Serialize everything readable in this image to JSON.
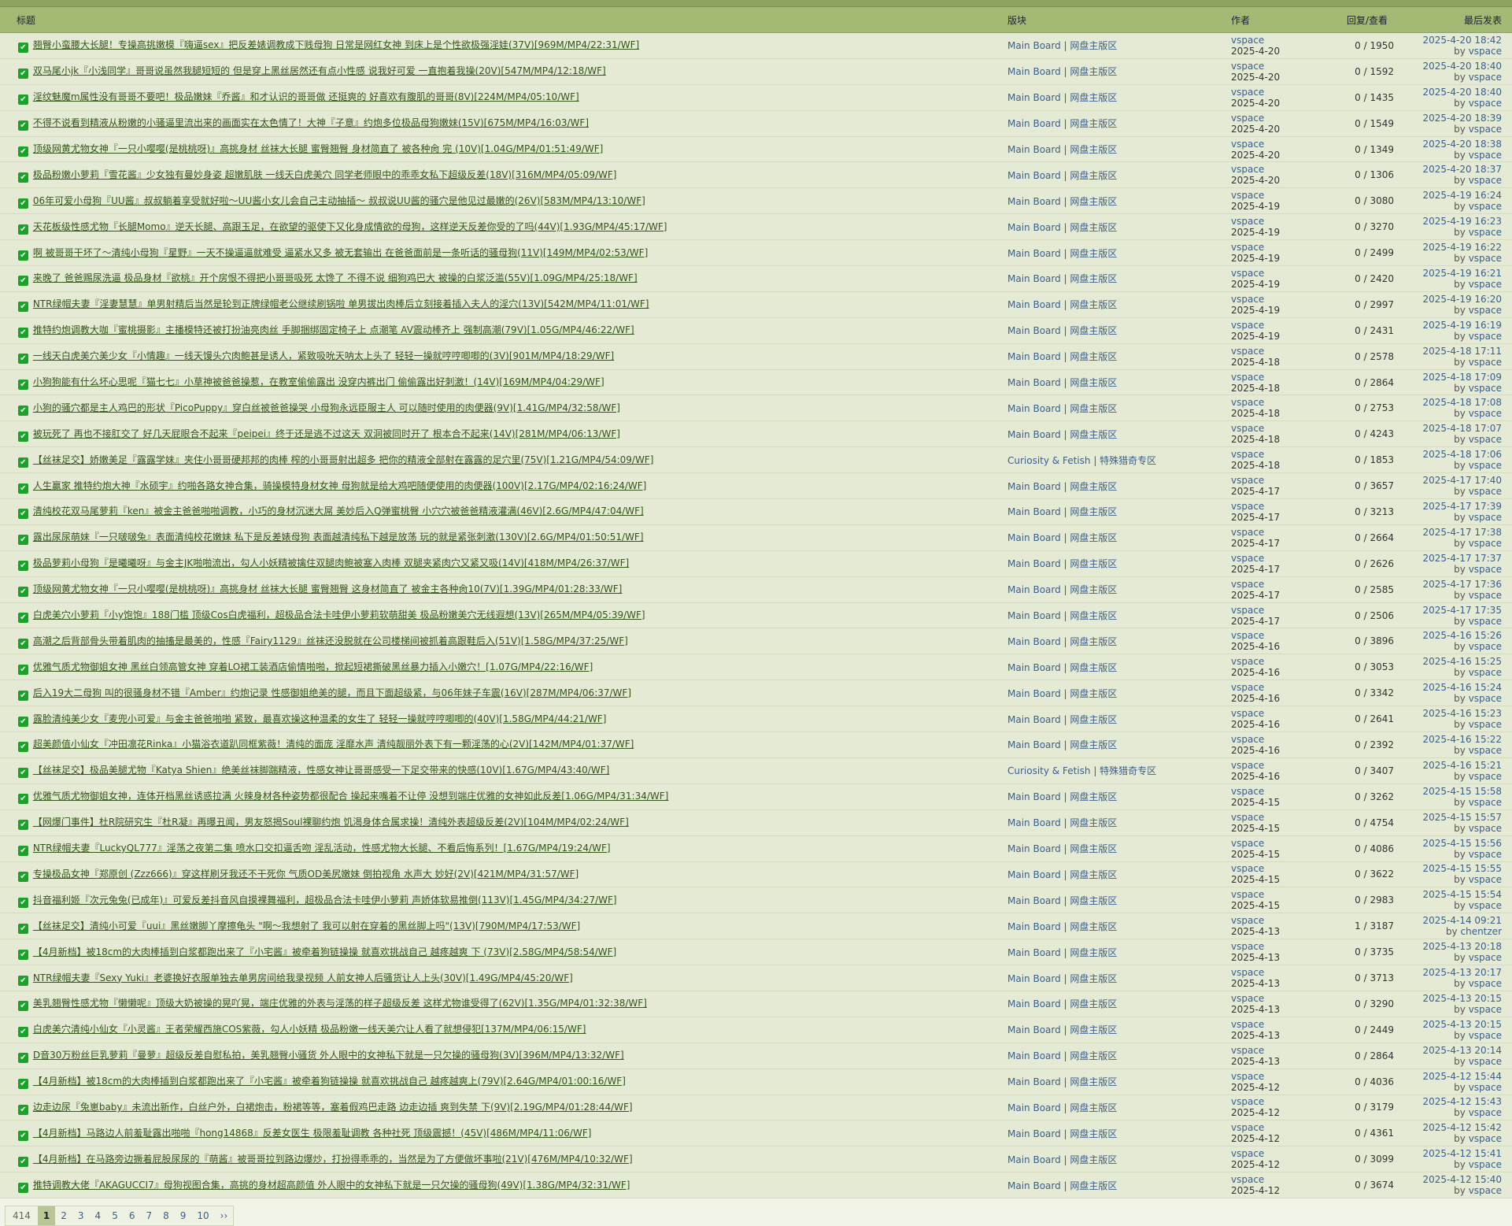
{
  "headers": {
    "title": "标题",
    "forum": "版块",
    "author": "作者",
    "count": "回复/查看",
    "last": "最后发表"
  },
  "threads": [
    {
      "title": "翘臀小蛮腰大长腿！专操高挑嫩模『嗨逼sex』把反差婊调教成下贱母狗 日常是网红女神 到床上是个性欲极强淫娃(37V)[969M/MP4/22:31/WF]",
      "forum": "Main Board | 网盘主版区",
      "author": "vspace",
      "date": "2025-4-20",
      "count": "0 / 1950",
      "last_time": "2025-4-20 18:42",
      "last_user": "vspace"
    },
    {
      "title": "双马尾小jk『小浅同学』哥哥说虽然我腿短短的 但是穿上黑丝居然还有点小性感 说我好可爱 一直抱着我操(20V)[547M/MP4/12:18/WF]",
      "forum": "Main Board | 网盘主版区",
      "author": "vspace",
      "date": "2025-4-20",
      "count": "0 / 1592",
      "last_time": "2025-4-20 18:40",
      "last_user": "vspace"
    },
    {
      "title": "淫纹魅魔m属性没有哥哥不要吧！极品嫩妹『乔酱』和才认识的哥哥做 还挺爽的 好喜欢有腹肌的哥哥(8V)[224M/MP4/05:10/WF]",
      "forum": "Main Board | 网盘主版区",
      "author": "vspace",
      "date": "2025-4-20",
      "count": "0 / 1435",
      "last_time": "2025-4-20 18:40",
      "last_user": "vspace"
    },
    {
      "title": "不得不说看到精液从粉嫩的小骚逼里流出来的画面实在太色情了！大神『子意』约炮多位极品母狗嫩妹(15V)[675M/MP4/16:03/WF]",
      "forum": "Main Board | 网盘主版区",
      "author": "vspace",
      "date": "2025-4-20",
      "count": "0 / 1549",
      "last_time": "2025-4-20 18:39",
      "last_user": "vspace"
    },
    {
      "title": "顶级网黄尤物女神『一只小嘤嘤(是桃桃呀)』高挑身材 丝袜大长腿 蜜臀翘臀 身材简直了 被各种肏 完 (10V)[1.04G/MP4/01:51:49/WF]",
      "forum": "Main Board | 网盘主版区",
      "author": "vspace",
      "date": "2025-4-20",
      "count": "0 / 1349",
      "last_time": "2025-4-20 18:38",
      "last_user": "vspace"
    },
    {
      "title": "极品粉嫩小萝莉『雪花酱』少女独有曼妙身姿 超嫩肌肤 一线天白虎美穴 同学老师眼中的乖乖女私下超级反差(18V)[316M/MP4/05:09/WF]",
      "forum": "Main Board | 网盘主版区",
      "author": "vspace",
      "date": "2025-4-20",
      "count": "0 / 1306",
      "last_time": "2025-4-20 18:37",
      "last_user": "vspace"
    },
    {
      "title": "06年可爱小母狗『UU酱』叔叔躺着享受就好啦～UU酱小女儿会自己主动抽插～ 叔叔说UU酱的骚穴是他见过最嫩的(26V)[583M/MP4/13:10/WF]",
      "forum": "Main Board | 网盘主版区",
      "author": "vspace",
      "date": "2025-4-19",
      "count": "0 / 3080",
      "last_time": "2025-4-19 16:24",
      "last_user": "vspace"
    },
    {
      "title": "天花板级性感尤物『长腿Momo』逆天长腿、高跟玉足，在欲望的驱使下又化身成情欲的母狗，这样逆天反差你受的了吗(44V)[1.93G/MP4/45:17/WF]",
      "forum": "Main Board | 网盘主版区",
      "author": "vspace",
      "date": "2025-4-19",
      "count": "0 / 3270",
      "last_time": "2025-4-19 16:23",
      "last_user": "vspace"
    },
    {
      "title": "啊 被哥哥干坏了～清纯小母狗『星野』一天不操逼逼就难受 逼紧水又多 被无套输出 在爸爸面前是一条听话的骚母狗(11V)[149M/MP4/02:53/WF]",
      "forum": "Main Board | 网盘主版区",
      "author": "vspace",
      "date": "2025-4-19",
      "count": "0 / 2499",
      "last_time": "2025-4-19 16:22",
      "last_user": "vspace"
    },
    {
      "title": "来晚了 爸爸赐尿洗逼 极品身材『欲桃』开个房恨不得把小哥哥吸死 太馋了 不得不说 细狗鸡巴大 被操的白浆泛滥(55V)[1.09G/MP4/25:18/WF]",
      "forum": "Main Board | 网盘主版区",
      "author": "vspace",
      "date": "2025-4-19",
      "count": "0 / 2420",
      "last_time": "2025-4-19 16:21",
      "last_user": "vspace"
    },
    {
      "title": "NTR绿帽夫妻『淫妻慧慧』单男射精后当然是轮到正牌绿帽老公继续刷锅啦 单男拔出肉棒后立刻接着插入夫人的淫穴(13V)[542M/MP4/11:01/WF]",
      "forum": "Main Board | 网盘主版区",
      "author": "vspace",
      "date": "2025-4-19",
      "count": "0 / 2997",
      "last_time": "2025-4-19 16:20",
      "last_user": "vspace"
    },
    {
      "title": "推特约炮调教大咖『蜜桃摄影』主播模特还被打扮油亮肉丝 手脚捆绑固定椅子上 点潮笔 AV震动棒齐上 强制高潮(79V)[1.05G/MP4/46:22/WF]",
      "forum": "Main Board | 网盘主版区",
      "author": "vspace",
      "date": "2025-4-19",
      "count": "0 / 2431",
      "last_time": "2025-4-19 16:19",
      "last_user": "vspace"
    },
    {
      "title": "一线天白虎美穴美少女『小情趣』一线天馒头穴肉鲍甚是诱人，紧致吸吮天呐太上头了 轻轻一操就哼哼唧唧的(3V)[901M/MP4/18:29/WF]",
      "forum": "Main Board | 网盘主版区",
      "author": "vspace",
      "date": "2025-4-18",
      "count": "0 / 2578",
      "last_time": "2025-4-18 17:11",
      "last_user": "vspace"
    },
    {
      "title": "小狗狗能有什么坏心思呢『猫七七』小草神被爸爸操惹，在教室偷偷露出 没穿内裤出门 偷偷露出好刺激！(14V)[169M/MP4/04:29/WF]",
      "forum": "Main Board | 网盘主版区",
      "author": "vspace",
      "date": "2025-4-18",
      "count": "0 / 2864",
      "last_time": "2025-4-18 17:09",
      "last_user": "vspace"
    },
    {
      "title": "小狗的骚穴都是主人鸡巴的形状『PicoPuppy』穿白丝被爸爸操哭 小母狗永远臣服主人 可以随时使用的肉便器(9V)[1.41G/MP4/32:58/WF]",
      "forum": "Main Board | 网盘主版区",
      "author": "vspace",
      "date": "2025-4-18",
      "count": "0 / 2753",
      "last_time": "2025-4-18 17:08",
      "last_user": "vspace"
    },
    {
      "title": "被玩死了 再也不接肛交了 好几天屁眼合不起来『peipei』终于还是逃不过这天 双洞被同时开了 根本合不起来(14V)[281M/MP4/06:13/WF]",
      "forum": "Main Board | 网盘主版区",
      "author": "vspace",
      "date": "2025-4-18",
      "count": "0 / 4243",
      "last_time": "2025-4-18 17:07",
      "last_user": "vspace"
    },
    {
      "title": "【丝袜足交】娇嫩美足『露露学妹』夹住小哥哥硬邦邦的肉棒 榨的小哥哥射出超多 把你的精液全部射在露露的足穴里(75V)[1.21G/MP4/54:09/WF]",
      "forum": "Curiosity & Fetish | 特殊猎奇专区",
      "author": "vspace",
      "date": "2025-4-18",
      "count": "0 / 1853",
      "last_time": "2025-4-18 17:06",
      "last_user": "vspace"
    },
    {
      "title": "人生赢家 推特约炮大神『水硕宇』约啪各路女神合集，骑操模特身材女神 母狗就是给大鸡吧随便使用的肉便器(100V)[2.17G/MP4/02:16:24/WF]",
      "forum": "Main Board | 网盘主版区",
      "author": "vspace",
      "date": "2025-4-17",
      "count": "0 / 3657",
      "last_time": "2025-4-17 17:40",
      "last_user": "vspace"
    },
    {
      "title": "清纯校花双马尾萝莉『ken』被金主爸爸啪啪调教，小巧的身材沉迷大屌 美妙后入Q弹蜜桃臀 小穴穴被爸爸精液灌满(46V)[2.6G/MP4/47:04/WF]",
      "forum": "Main Board | 网盘主版区",
      "author": "vspace",
      "date": "2025-4-17",
      "count": "0 / 3213",
      "last_time": "2025-4-17 17:39",
      "last_user": "vspace"
    },
    {
      "title": "露出尿尿萌妹『一只啵啵兔』表面清纯校花嫩妹 私下是反差婊母狗 表面越清纯私下越是放荡 玩的就是紧张刺激(130V)[2.6G/MP4/01:50:51/WF]",
      "forum": "Main Board | 网盘主版区",
      "author": "vspace",
      "date": "2025-4-17",
      "count": "0 / 2664",
      "last_time": "2025-4-17 17:38",
      "last_user": "vspace"
    },
    {
      "title": "极品萝莉小母狗『是曦曦呀』与金主JK啪啪流出，勾人小妖精被擒住双腿肉鲍被塞入肉棒 双腿夹紧肉穴又紧又吸(14V)[418M/MP4/26:37/WF]",
      "forum": "Main Board | 网盘主版区",
      "author": "vspace",
      "date": "2025-4-17",
      "count": "0 / 2626",
      "last_time": "2025-4-17 17:37",
      "last_user": "vspace"
    },
    {
      "title": "顶级网黄尤物女神『一只小嘤嘤(是桃桃呀)』高挑身材 丝袜大长腿 蜜臀翘臀 这身材简直了 被金主各种肏10(7V)[1.39G/MP4/01:28:33/WF]",
      "forum": "Main Board | 网盘主版区",
      "author": "vspace",
      "date": "2025-4-17",
      "count": "0 / 2585",
      "last_time": "2025-4-17 17:36",
      "last_user": "vspace"
    },
    {
      "title": "白虎美穴小萝莉『小y饱饱』188门槛 顶级Cos白虎福利，超极品合法卡哇伊小萝莉软萌甜美 极品粉嫩美穴无线遐想(13V)[265M/MP4/05:39/WF]",
      "forum": "Main Board | 网盘主版区",
      "author": "vspace",
      "date": "2025-4-17",
      "count": "0 / 2506",
      "last_time": "2025-4-17 17:35",
      "last_user": "vspace"
    },
    {
      "title": "高潮之后背部骨头带着肌肉的抽搐是最美的，性感『Fairy1129』丝袜还没脱就在公司楼梯间被抓着高跟鞋后入(51V)[1.58G/MP4/37:25/WF]",
      "forum": "Main Board | 网盘主版区",
      "author": "vspace",
      "date": "2025-4-16",
      "count": "0 / 3896",
      "last_time": "2025-4-16 15:26",
      "last_user": "vspace"
    },
    {
      "title": "优雅气质尤物御姐女神 黑丝白领高管女神 穿着LO裙工装酒店偷情啪啪，掀起短裙撕破黑丝暴力插入小嫩穴！[1.07G/MP4/22:16/WF]",
      "forum": "Main Board | 网盘主版区",
      "author": "vspace",
      "date": "2025-4-16",
      "count": "0 / 3053",
      "last_time": "2025-4-16 15:25",
      "last_user": "vspace"
    },
    {
      "title": "后入19大二母狗 叫的很骚身材不错『Amber』约炮记录 性感御姐绝美的腿，而且下面超级紧，与06年妹子车震(16V)[287M/MP4/06:37/WF]",
      "forum": "Main Board | 网盘主版区",
      "author": "vspace",
      "date": "2025-4-16",
      "count": "0 / 3342",
      "last_time": "2025-4-16 15:24",
      "last_user": "vspace"
    },
    {
      "title": "露脸清纯美少女『麦兜小可爱』与金主爸爸啪啪 紧致，最喜欢操这种温柔的女生了 轻轻一操就哼哼唧唧的(40V)[1.58G/MP4/44:21/WF]",
      "forum": "Main Board | 网盘主版区",
      "author": "vspace",
      "date": "2025-4-16",
      "count": "0 / 2641",
      "last_time": "2025-4-16 15:23",
      "last_user": "vspace"
    },
    {
      "title": "超美颜值小仙女『冲田凛花Rinka』小猫浴衣道趴同框紫薇！清纯的面庞 淫靡水声 清纯靓丽外表下有一颗淫荡的心(2V)[142M/MP4/01:37/WF]",
      "forum": "Main Board | 网盘主版区",
      "author": "vspace",
      "date": "2025-4-16",
      "count": "0 / 2392",
      "last_time": "2025-4-16 15:22",
      "last_user": "vspace"
    },
    {
      "title": "【丝袜足交】极品美腿尤物『Katya Shien』绝美丝袜脚踹精液，性感女神让哥哥感受一下足交带来的快感(10V)[1.67G/MP4/43:40/WF]",
      "forum": "Curiosity & Fetish | 特殊猎奇专区",
      "author": "vspace",
      "date": "2025-4-16",
      "count": "0 / 3407",
      "last_time": "2025-4-16 15:21",
      "last_user": "vspace"
    },
    {
      "title": "优雅气质尤物御姐女神，连体开档黑丝诱惑拉满 火辣身材各种姿势都很配合 操起来嘴着不让停 没想到端庄优雅的女神如此反差[1.06G/MP4/31:34/WF]",
      "forum": "Main Board | 网盘主版区",
      "author": "vspace",
      "date": "2025-4-15",
      "count": "0 / 3262",
      "last_time": "2025-4-15 15:58",
      "last_user": "vspace"
    },
    {
      "title": "【网爆门事件】杜R院研究生『杜R凝』再曝丑闻，男友怒揭Soul裸聊约炮 饥渴身体合属求操！清纯外表超级反差(2V)[104M/MP4/02:24/WF]",
      "forum": "Main Board | 网盘主版区",
      "author": "vspace",
      "date": "2025-4-15",
      "count": "0 / 4754",
      "last_time": "2025-4-15 15:57",
      "last_user": "vspace"
    },
    {
      "title": "NTR绿帽夫妻『LuckyQL777』淫荡之夜第二集 喷水口交扣逼舌吻 淫乱活动，性感尤物大长腿、不看后悔系列！[1.67G/MP4/19:24/WF]",
      "forum": "Main Board | 网盘主版区",
      "author": "vspace",
      "date": "2025-4-15",
      "count": "0 / 4086",
      "last_time": "2025-4-15 15:56",
      "last_user": "vspace"
    },
    {
      "title": "专操极品女神『郑原创 (Zzz666)』穿这样刷牙我还不干死你 气质OD美尻嫩妹 倒拍视角 水声大 妙好(2V)[421M/MP4/31:57/WF]",
      "forum": "Main Board | 网盘主版区",
      "author": "vspace",
      "date": "2025-4-15",
      "count": "0 / 3622",
      "last_time": "2025-4-15 15:55",
      "last_user": "vspace"
    },
    {
      "title": "抖音福利姬『次元兔兔(已成年)』可爱反差抖音风自摸裸舞福利，超极品合法卡哇伊小萝莉 声娇体软易推倒(113V)[1.45G/MP4/34:27/WF]",
      "forum": "Main Board | 网盘主版区",
      "author": "vspace",
      "date": "2025-4-15",
      "count": "0 / 2983",
      "last_time": "2025-4-15 15:54",
      "last_user": "vspace"
    },
    {
      "title": "【丝袜足交】清纯小可爱『uui』黑丝嫩脚丫摩擦龟头 \"啊～我想射了 我可以射在穿着的黑丝脚上吗\"(13V)[790M/MP4/17:53/WF]",
      "forum": "Main Board | 网盘主版区",
      "author": "vspace",
      "date": "2025-4-13",
      "count": "1 / 3187",
      "last_time": "2025-4-14 09:21",
      "last_user": "chentzer"
    },
    {
      "title": "【4月新档】被18cm的大肉棒插到白浆都跑出来了『小宅酱』被牵着狗链操操 就喜欢挑战自己 越疼越爽 下 (73V)[2.58G/MP4/58:54/WF]",
      "forum": "Main Board | 网盘主版区",
      "author": "vspace",
      "date": "2025-4-13",
      "count": "0 / 3735",
      "last_time": "2025-4-13 20:18",
      "last_user": "vspace"
    },
    {
      "title": "NTR绿帽夫妻『Sexy Yuki』老婆换好衣服单独去单男房间给我录视频 人前女神人后骚货让人上头(30V)[1.49G/MP4/45:20/WF]",
      "forum": "Main Board | 网盘主版区",
      "author": "vspace",
      "date": "2025-4-13",
      "count": "0 / 3713",
      "last_time": "2025-4-13 20:17",
      "last_user": "vspace"
    },
    {
      "title": "美乳翘臀性感尤物『懒懒呢』顶级大奶被操的晃吖晃，端庄优雅的外表与淫荡的样子超级反差 这样尤物谁受得了(62V)[1.35G/MP4/01:32:38/WF]",
      "forum": "Main Board | 网盘主版区",
      "author": "vspace",
      "date": "2025-4-13",
      "count": "0 / 3290",
      "last_time": "2025-4-13 20:15",
      "last_user": "vspace"
    },
    {
      "title": "白虎美穴清纯小仙女『小灵酱』王者荣耀西施COS紫薇，勾人小妖精 极品粉嫩一线天美穴让人看了就想侵犯[137M/MP4/06:15/WF]",
      "forum": "Main Board | 网盘主版区",
      "author": "vspace",
      "date": "2025-4-13",
      "count": "0 / 2449",
      "last_time": "2025-4-13 20:15",
      "last_user": "vspace"
    },
    {
      "title": "D音30万粉丝巨乳萝莉『曼萝』超级反差自慰私拍，美乳翘臀小骚货 外人眼中的女神私下就是一只欠操的骚母狗(3V)[396M/MP4/13:32/WF]",
      "forum": "Main Board | 网盘主版区",
      "author": "vspace",
      "date": "2025-4-13",
      "count": "0 / 2864",
      "last_time": "2025-4-13 20:14",
      "last_user": "vspace"
    },
    {
      "title": "【4月新档】被18cm的大肉棒插到白浆都跑出来了『小宅酱』被牵着狗链操操 就喜欢挑战自己 越疼越爽上(79V)[2.64G/MP4/01:00:16/WF]",
      "forum": "Main Board | 网盘主版区",
      "author": "vspace",
      "date": "2025-4-12",
      "count": "0 / 4036",
      "last_time": "2025-4-12 15:44",
      "last_user": "vspace"
    },
    {
      "title": "边走边尿『兔崽baby』未流出新作，白丝户外，白裙炮击，粉裙等等，塞着假鸡巴走路 边走边插 爽到失禁 下(9V)[2.19G/MP4/01:28:44/WF]",
      "forum": "Main Board | 网盘主版区",
      "author": "vspace",
      "date": "2025-4-12",
      "count": "0 / 3179",
      "last_time": "2025-4-12 15:43",
      "last_user": "vspace"
    },
    {
      "title": "【4月新档】马路边人前羞耻露出啪啪『hong14868』反差女医生 极限羞耻调教 各种社死 顶级震撼！(45V)[486M/MP4/11:06/WF]",
      "forum": "Main Board | 网盘主版区",
      "author": "vspace",
      "date": "2025-4-12",
      "count": "0 / 4361",
      "last_time": "2025-4-12 15:42",
      "last_user": "vspace"
    },
    {
      "title": "【4月新档】在马路旁边撅着屁股尿尿的『萌酱』被哥哥拉到路边爆炒，打扮得乖乖的，当然是为了方便做坏事啦(21V)[476M/MP4/10:32/WF]",
      "forum": "Main Board | 网盘主版区",
      "author": "vspace",
      "date": "2025-4-12",
      "count": "0 / 3099",
      "last_time": "2025-4-12 15:41",
      "last_user": "vspace"
    },
    {
      "title": "推特调教大佬『AKAGUCCI7』母狗视图合集，高挑的身材超高颜值 外人眼中的女神私下就是一只欠操的骚母狗(49V)[1.38G/MP4/32:31/WF]",
      "forum": "Main Board | 网盘主版区",
      "author": "vspace",
      "date": "2025-4-12",
      "count": "0 / 3674",
      "last_time": "2025-4-12 15:40",
      "last_user": "vspace"
    }
  ],
  "by_label": "by",
  "check_glyph": "✔",
  "pager": {
    "total": "414",
    "pages": [
      "1",
      "2",
      "3",
      "4",
      "5",
      "6",
      "7",
      "8",
      "9",
      "10"
    ],
    "current": "1",
    "next": "››"
  }
}
